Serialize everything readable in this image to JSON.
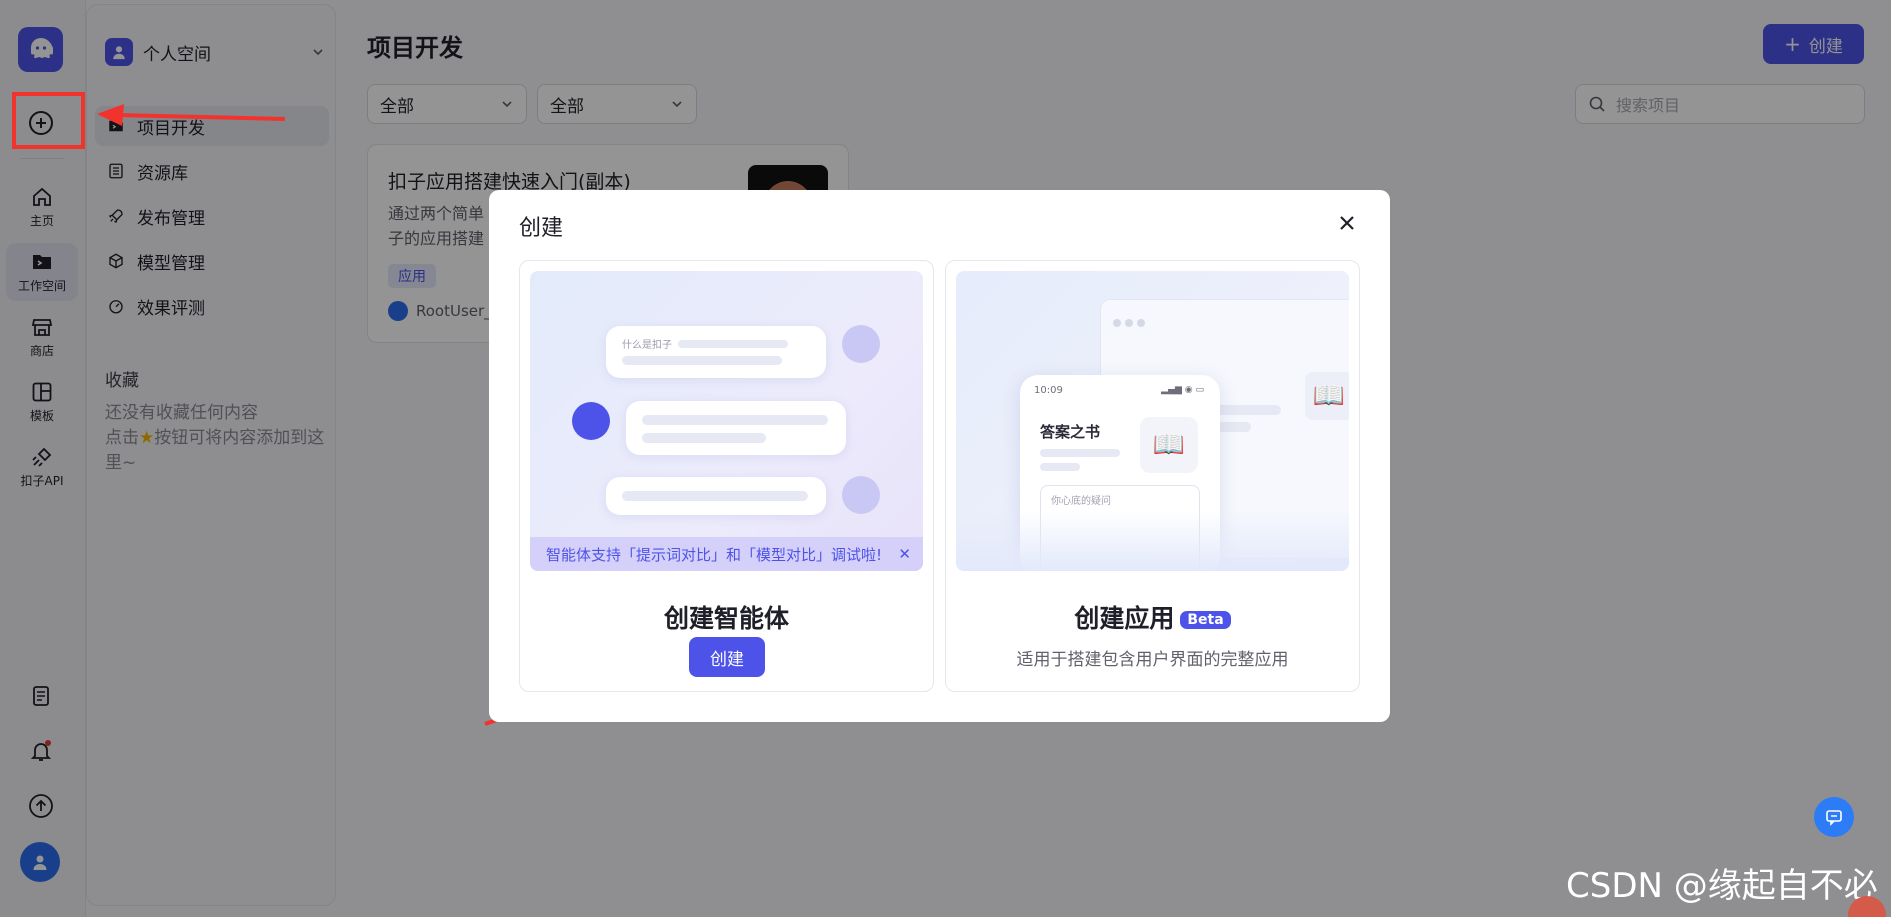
{
  "rail": {
    "items": [
      {
        "label": "主页",
        "icon": "home-icon"
      },
      {
        "label": "工作空间",
        "icon": "workspace-icon"
      },
      {
        "label": "商店",
        "icon": "store-icon"
      },
      {
        "label": "模板",
        "icon": "template-icon"
      },
      {
        "label": "扣子API",
        "icon": "api-icon"
      }
    ]
  },
  "sidebar": {
    "space_name": "个人空间",
    "nav": [
      {
        "label": "项目开发",
        "icon": "project-icon"
      },
      {
        "label": "资源库",
        "icon": "library-icon"
      },
      {
        "label": "发布管理",
        "icon": "rocket-icon"
      },
      {
        "label": "模型管理",
        "icon": "cube-icon"
      },
      {
        "label": "效果评测",
        "icon": "gauge-icon"
      }
    ],
    "favorites_title": "收藏",
    "favorites_empty": "还没有收藏任何内容",
    "favorites_hint_a": "点击",
    "favorites_hint_b": "按钮可将内容添加到这里~"
  },
  "main": {
    "title": "项目开发",
    "create_label": "创建",
    "filter_1": "全部",
    "filter_2": "全部",
    "search_placeholder": "搜索项目",
    "card": {
      "title": "扣子应用搭建快速入门(副本)",
      "desc": "通过两个简单\n子的应用搭建",
      "tag": "应用",
      "user": "RootUser_"
    }
  },
  "modal": {
    "title": "创建",
    "agent": {
      "title": "创建智能体",
      "button": "创建",
      "banner": "智能体支持「提示词对比」和「模型对比」调试啦!",
      "chat_hint": "什么是扣子"
    },
    "app": {
      "title": "创建应用",
      "badge": "Beta",
      "subtitle": "适用于搭建包含用户界面的完整应用",
      "phone_time": "10:09",
      "book_title": "答案之书",
      "input_hint": "你心底的疑问"
    }
  },
  "watermark": "CSDN @缘起自不必",
  "colors": {
    "accent": "#4d53e8",
    "annotation": "#f2322c"
  }
}
